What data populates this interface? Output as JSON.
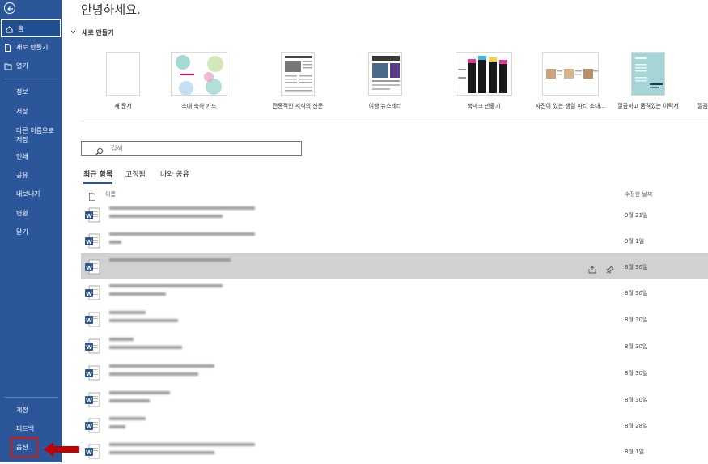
{
  "sidebar": {
    "back_icon": "back-arrow-icon",
    "home": "홈",
    "new": "새로 만들기",
    "open": "열기",
    "info": "정보",
    "save": "저장",
    "save_as_line1": "다른 이름으로",
    "save_as_line2": "저장",
    "print": "인쇄",
    "share": "공유",
    "export": "내보내기",
    "transform": "변환",
    "close": "닫기",
    "account": "계정",
    "feedback": "피드백",
    "options": "옵션"
  },
  "main": {
    "greeting": "안녕하세요.",
    "new_section": "새로 만들기",
    "templates": [
      {
        "label": "새 문서"
      },
      {
        "label": "초대 축하 카드"
      },
      {
        "label": "전통적인 서식의 신문"
      },
      {
        "label": "여행 뉴스레터"
      },
      {
        "label": "북마크 만들기"
      },
      {
        "label": "사진이 있는 생일 파티 초대..."
      },
      {
        "label": "깔끔하고 품격있는 이력서"
      },
      {
        "label": "깔끔"
      }
    ],
    "search": {
      "placeholder": "검색"
    },
    "tabs": {
      "recent": "최근 항목",
      "pinned": "고정됨",
      "shared": "나와 공유"
    },
    "columns": {
      "name": "이름",
      "date": "수정한 날짜"
    },
    "files": [
      {
        "date": "9월 21일"
      },
      {
        "date": "9월 1일"
      },
      {
        "date": "8월 30일"
      },
      {
        "date": "8월 30일"
      },
      {
        "date": "8월 30일"
      },
      {
        "date": "8월 30일"
      },
      {
        "date": "8월 30일"
      },
      {
        "date": "8월 30일"
      },
      {
        "date": "8월 28일"
      },
      {
        "date": "8월 1일"
      }
    ]
  },
  "colors": {
    "sidebar": "#2b579a",
    "highlight": "#d11a1a",
    "arrow": "#c00000",
    "word_blue": "#2b579a"
  }
}
